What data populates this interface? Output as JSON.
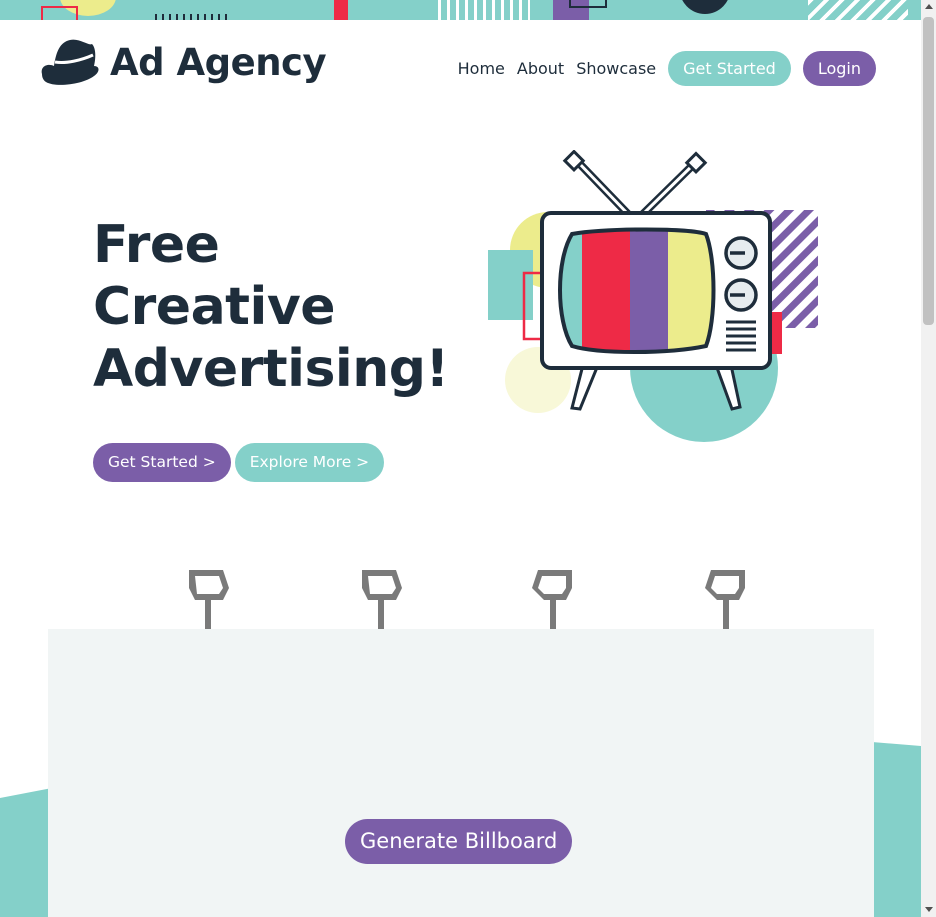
{
  "brand": {
    "name": "Ad Agency",
    "logo_icon": "fedora-hat-icon"
  },
  "nav": {
    "links": [
      "Home",
      "About",
      "Showcase"
    ],
    "get_started": "Get Started",
    "login": "Login"
  },
  "hero": {
    "title_lines": [
      "Free",
      "Creative",
      "Advertising!"
    ],
    "primary_button": "Get Started >",
    "secondary_button": "Explore More >",
    "illustration": "retro-tv-illustration"
  },
  "billboard": {
    "lamp_icon": "spotlight-lamp-icon",
    "generate_button": "Generate Billboard"
  },
  "colors": {
    "navy": "#1e2d3b",
    "teal": "#84d0c9",
    "purple": "#7b5ea8",
    "red": "#ee2a46",
    "yellow": "#ecec8c",
    "billboard_bg": "#f1f5f5"
  }
}
